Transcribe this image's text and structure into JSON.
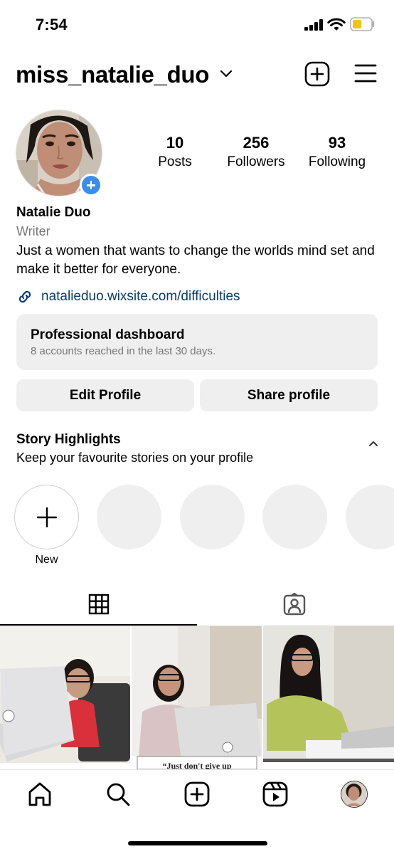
{
  "status_bar": {
    "time": "7:54"
  },
  "header": {
    "username": "miss_natalie_duo"
  },
  "profile": {
    "stats": [
      {
        "value": "10",
        "label": "Posts"
      },
      {
        "value": "256",
        "label": "Followers"
      },
      {
        "value": "93",
        "label": "Following"
      }
    ],
    "full_name": "Natalie Duo",
    "category": "Writer",
    "bio": "Just a women that wants to change the worlds mind set and make it better for everyone.",
    "link": "natalieduo.wixsite.com/difficulties"
  },
  "dashboard": {
    "title": "Professional dashboard",
    "subtitle": "8 accounts reached in the last 30 days."
  },
  "actions": {
    "edit_label": "Edit Profile",
    "share_label": "Share profile"
  },
  "highlights": {
    "title": "Story Highlights",
    "subtitle": "Keep your favourite stories on your profile",
    "new_label": "New"
  },
  "posts": [
    {
      "caption": ""
    },
    {
      "caption": "“Just don't give up"
    },
    {
      "caption": ""
    }
  ],
  "colors": {
    "accent_blue": "#3a8de8",
    "link_color": "#0b3a6b",
    "chip_bg": "#efefef"
  },
  "icons": [
    "signal-icon",
    "wifi-icon",
    "battery-icon",
    "chevron-down-icon",
    "new-post-icon",
    "menu-icon",
    "add-story-icon",
    "link-icon",
    "chevron-up-icon",
    "plus-icon",
    "grid-icon",
    "tagged-icon",
    "home-icon",
    "search-icon",
    "create-icon",
    "reels-icon"
  ]
}
